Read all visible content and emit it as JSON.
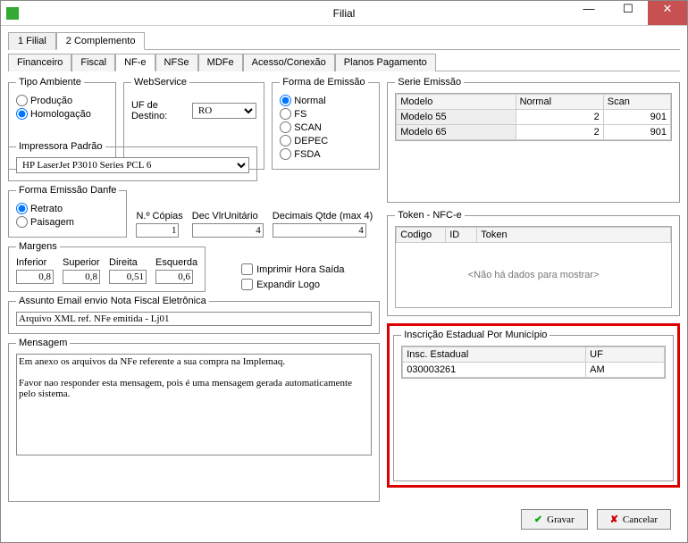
{
  "window": {
    "title": "Filial"
  },
  "tabs": {
    "t1": "1 Filial",
    "t2": "2 Complemento"
  },
  "subtabs": {
    "fin": "Financeiro",
    "fis": "Fiscal",
    "nfe": "NF-e",
    "nfse": "NFSe",
    "mdfe": "MDFe",
    "acesso": "Acesso/Conexão",
    "planos": "Planos Pagamento"
  },
  "tipoAmbiente": {
    "legend": "Tipo Ambiente",
    "producao": "Produção",
    "homolog": "Homologação"
  },
  "webservice": {
    "legend": "WebService",
    "ufLabel": "UF de Destino:",
    "ufValue": "RO"
  },
  "formaEmissao": {
    "legend": "Forma de Emissão",
    "normal": "Normal",
    "fs": "FS",
    "scan": "SCAN",
    "depec": "DEPEC",
    "fsda": "FSDA"
  },
  "impressora": {
    "legend": "Impressora Padrão",
    "value": "HP LaserJet P3010 Series PCL 6"
  },
  "danfe": {
    "legend": "Forma Emissão Danfe",
    "retrato": "Retrato",
    "paisagem": "Paisagem",
    "copiasLbl": "N.º Cópias",
    "copias": "1",
    "decVlrLbl": "Dec VlrUnitário",
    "decVlr": "4",
    "decQtdeLbl": "Decimais Qtde (max 4)",
    "decQtde": "4"
  },
  "margens": {
    "legend": "Margens",
    "inf": "Inferior",
    "sup": "Superior",
    "dir": "Direita",
    "esq": "Esquerda",
    "infV": "0,8",
    "supV": "0,8",
    "dirV": "0,51",
    "esqV": "0,6"
  },
  "checks": {
    "imprHora": "Imprimir Hora Saída",
    "expLogo": "Expandir Logo"
  },
  "assunto": {
    "legend": "Assunto Email envio Nota Fiscal Eletrônica",
    "value": "Arquivo XML ref. NFe emitida - Lj01"
  },
  "mensagem": {
    "legend": "Mensagem",
    "value": "Em anexo os arquivos da NFe referente a sua compra na Implemaq.\n\nFavor nao responder esta mensagem, pois é uma mensagem gerada automaticamente pelo sistema."
  },
  "serie": {
    "legend": "Serie Emissão",
    "hModelo": "Modelo",
    "hNormal": "Normal",
    "hScan": "Scan",
    "r1m": "Modelo 55",
    "r1n": "2",
    "r1s": "901",
    "r2m": "Modelo 65",
    "r2n": "2",
    "r2s": "901"
  },
  "token": {
    "legend": "Token - NFC-e",
    "hCodigo": "Codigo",
    "hId": "ID",
    "hToken": "Token",
    "empty": "<Não há dados para mostrar>"
  },
  "insc": {
    "legend": "Inscrição Estadual Por Município",
    "hInsc": "Insc. Estadual",
    "hUf": "UF",
    "v1": "030003261",
    "v2": "AM"
  },
  "buttons": {
    "gravar": "Gravar",
    "cancelar": "Cancelar"
  }
}
